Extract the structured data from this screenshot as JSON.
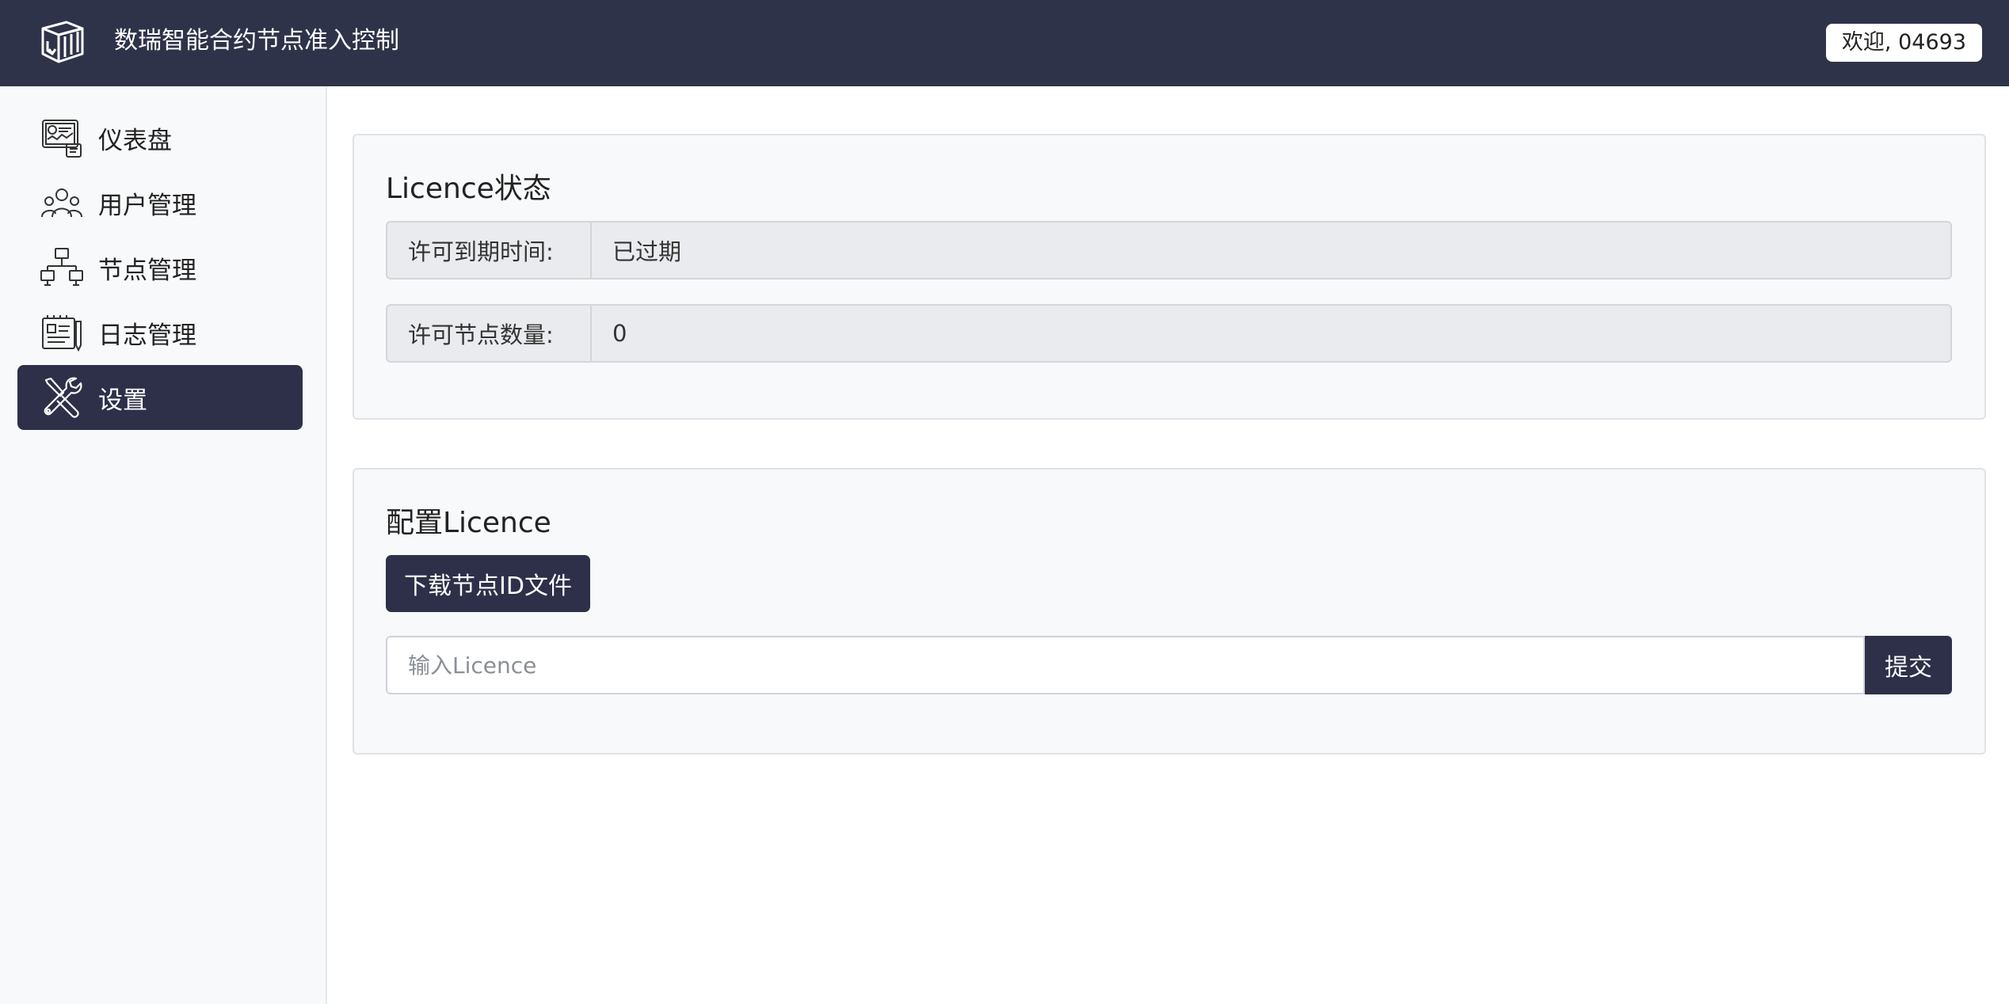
{
  "header": {
    "app_title": "数瑞智能合约节点准入控制",
    "welcome": "欢迎, 04693",
    "logo_icon": "box-logo-icon"
  },
  "sidebar": {
    "items": [
      {
        "label": "仪表盘",
        "icon": "dashboard-icon"
      },
      {
        "label": "用户管理",
        "icon": "users-icon"
      },
      {
        "label": "节点管理",
        "icon": "network-icon"
      },
      {
        "label": "日志管理",
        "icon": "log-icon"
      },
      {
        "label": "设置",
        "icon": "tools-icon",
        "active": true
      }
    ]
  },
  "licence_status": {
    "title": "Licence状态",
    "expiry_label": "许可到期时间:",
    "expiry_value": "已过期",
    "nodes_label": "许可节点数量:",
    "nodes_value": "0"
  },
  "licence_config": {
    "title": "配置Licence",
    "download_button": "下载节点ID文件",
    "input_placeholder": "输入Licence",
    "submit_button": "提交"
  },
  "colors": {
    "topbar": "#2f3349",
    "accent_dark": "#2d3048",
    "sidebar_bg": "#f8f9fb"
  }
}
